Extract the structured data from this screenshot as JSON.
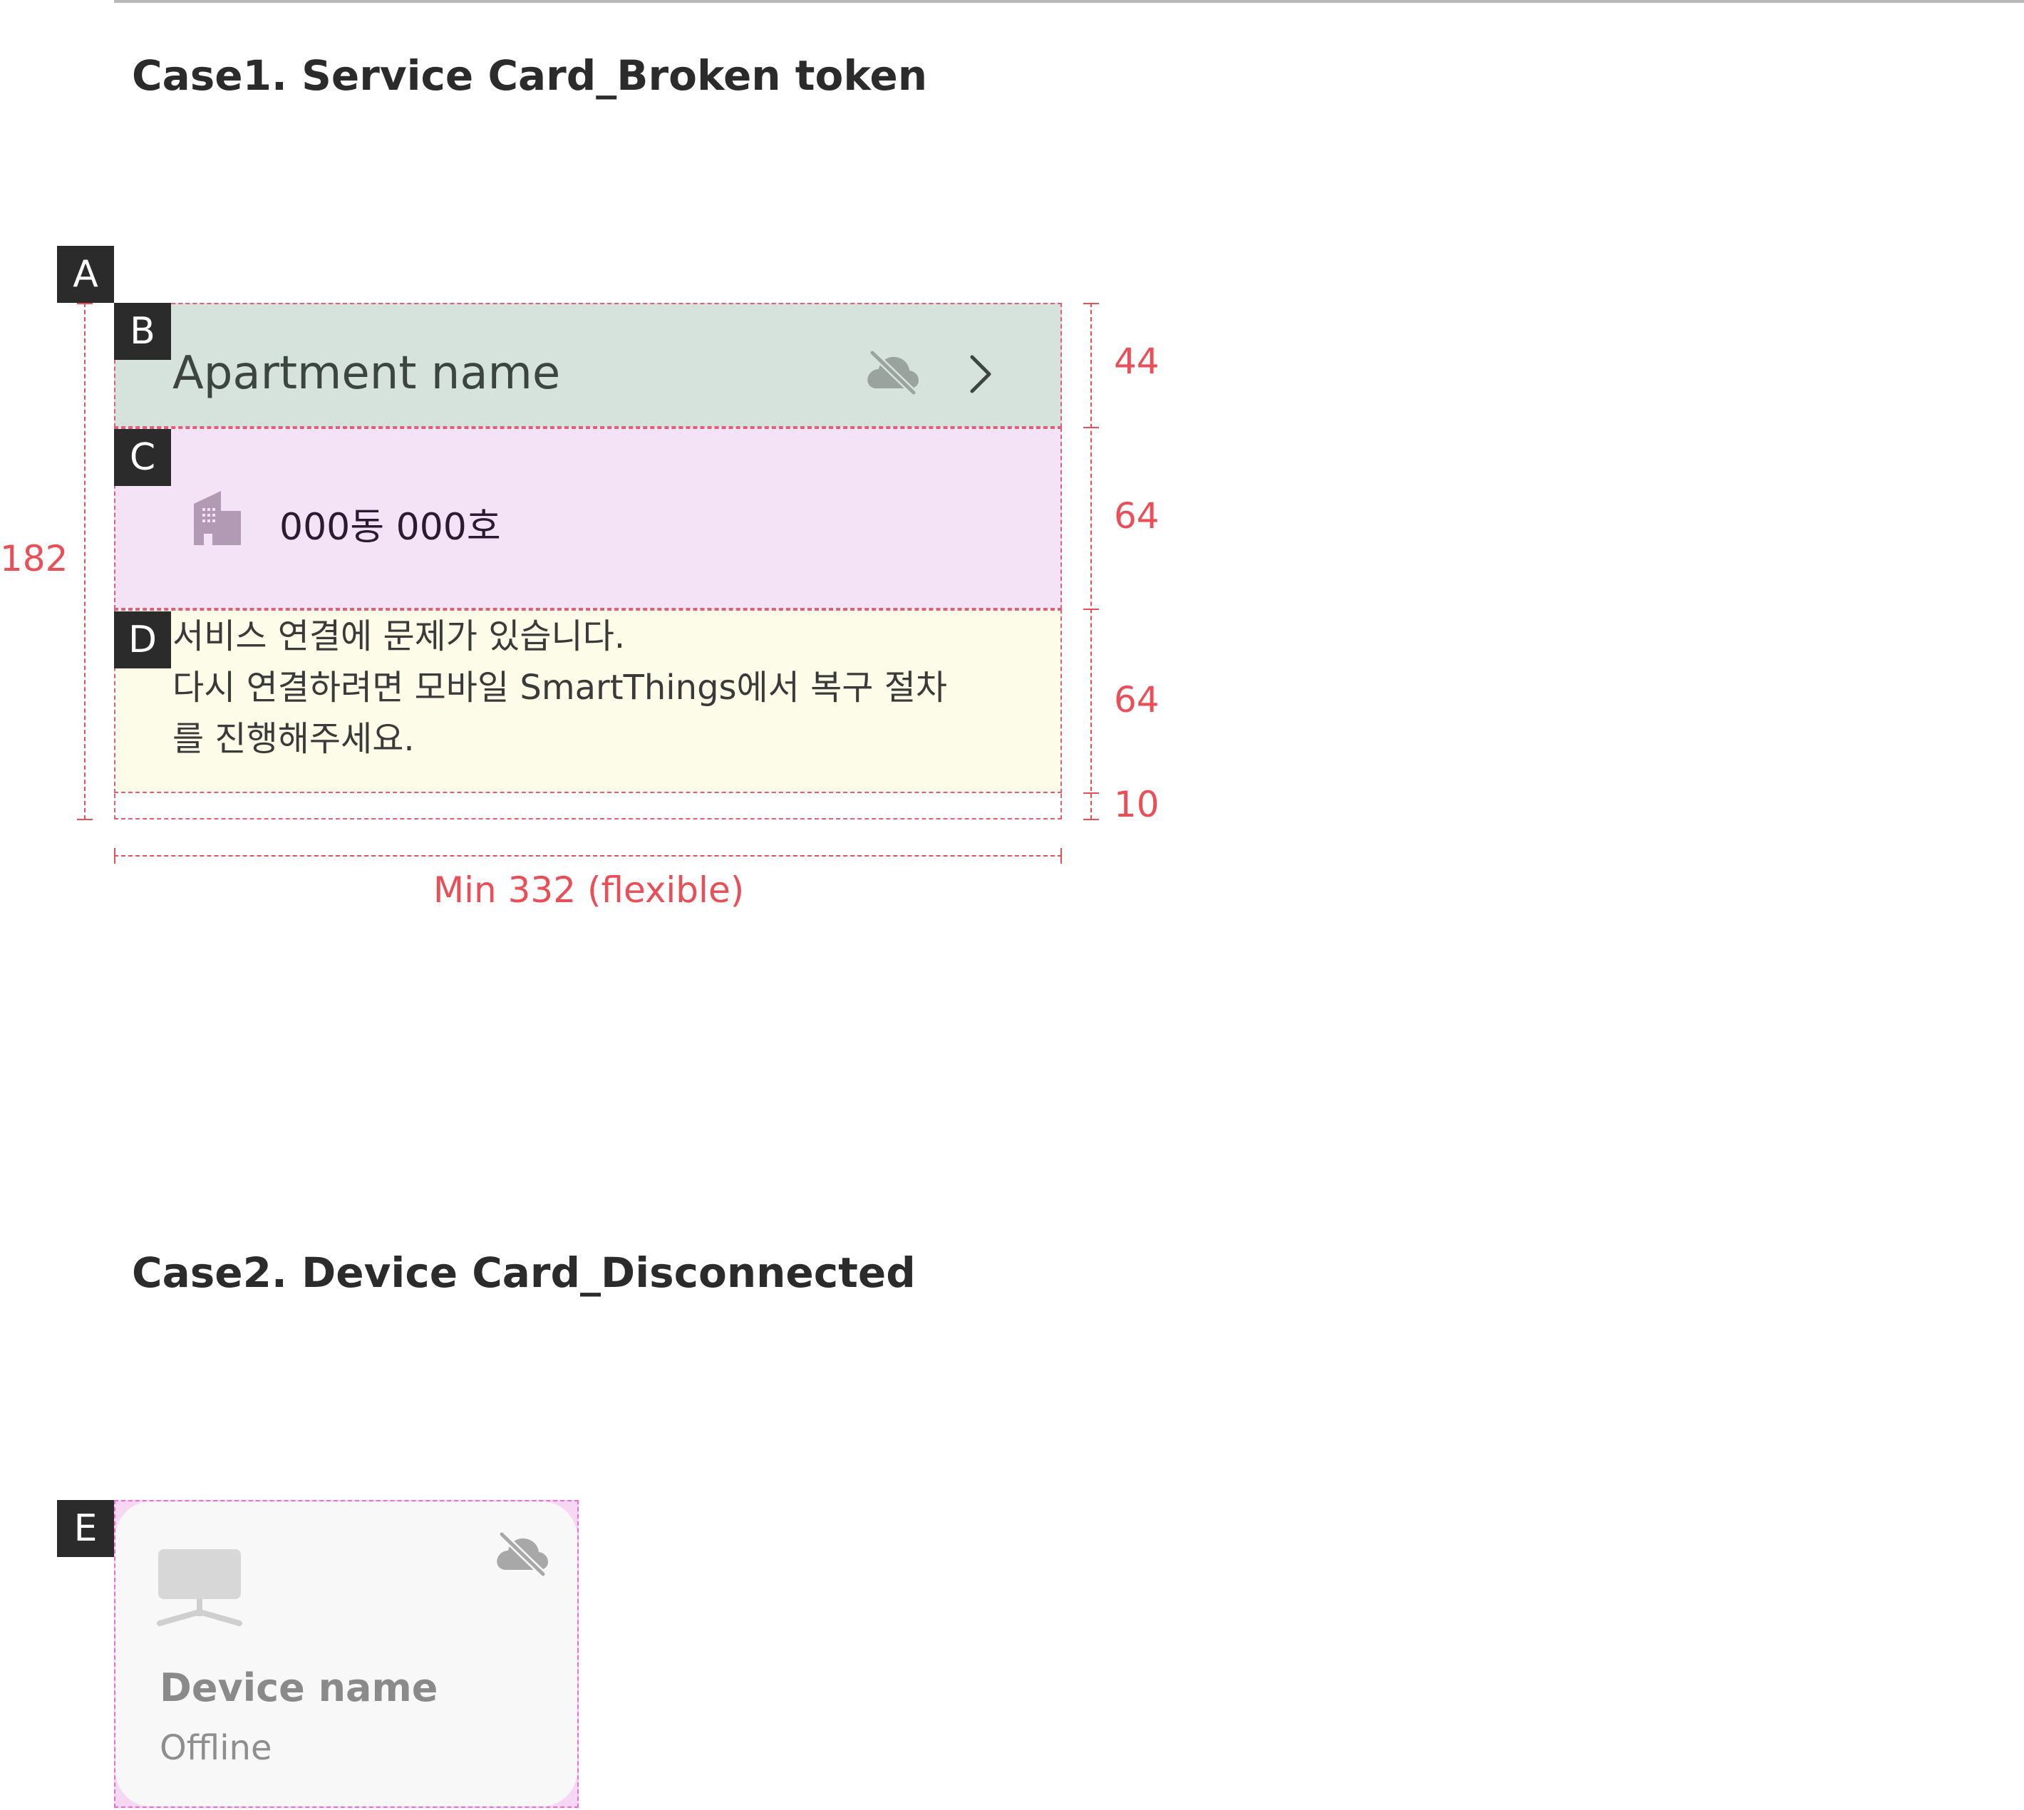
{
  "case1": {
    "title": "Case1. Service Card_Broken token",
    "labels": {
      "a": "A",
      "b": "B",
      "c": "C",
      "d": "D"
    },
    "apartment_name": "Apartment name",
    "unit": "000동 000호",
    "message": {
      "line1": "서비스 연결에 문제가 있습니다.",
      "line2": "다시 연결하려면 모바일 SmartThings에서 복구 절차",
      "line3": "를 진행해주세요."
    },
    "dimensions": {
      "total_height": "182",
      "header_height": "44",
      "unit_height": "64",
      "message_height": "64",
      "bottom_padding": "10",
      "width": "Min 332 (flexible)"
    },
    "icons": {
      "cloud_off": "cloud-off-icon",
      "chevron": "chevron-right-icon",
      "building": "building-icon"
    }
  },
  "case2": {
    "title": "Case2. Device Card_Disconnected",
    "label": "E",
    "device_name": "Device name",
    "status": "Offline",
    "icons": {
      "monitor": "monitor-icon",
      "cloud_off": "cloud-off-icon"
    }
  },
  "colors": {
    "header_bg": "#d5e3dc",
    "unit_bg": "#f4e3f6",
    "message_bg": "#fdfce9",
    "dimension_red": "#ea4f57",
    "label_dark": "#2b2b2b"
  }
}
